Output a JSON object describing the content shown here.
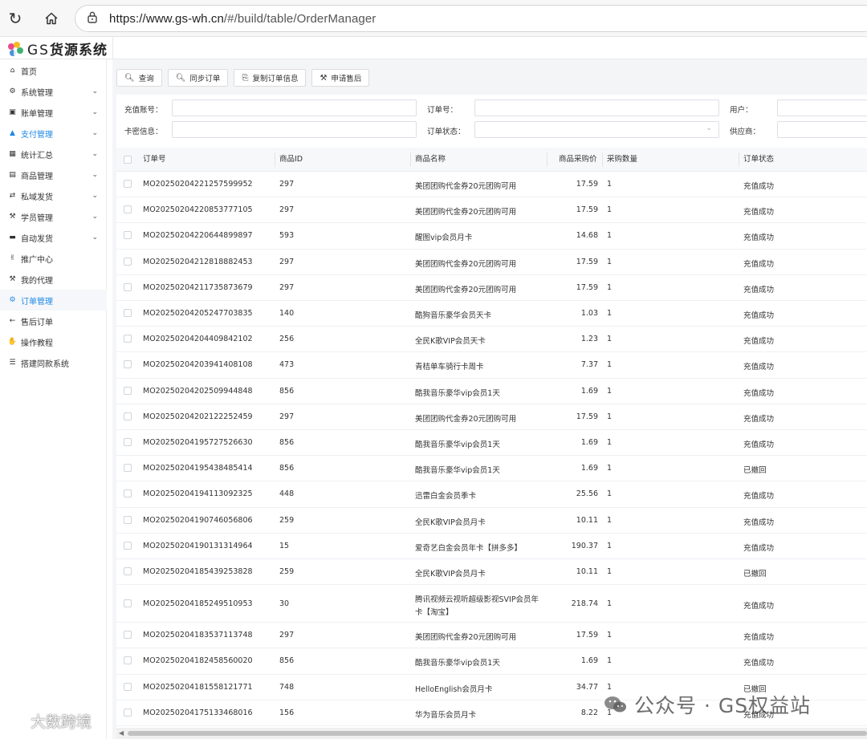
{
  "browser": {
    "url_host": "https://www.gs-wh.cn",
    "url_path": "/#/build/table/OrderManager"
  },
  "app": {
    "logo_prefix": "GS",
    "logo_title": "货源系统"
  },
  "sidebar": {
    "items": [
      {
        "label": "首页",
        "icon": "home-icon",
        "has_arrow": false
      },
      {
        "label": "系统管理",
        "icon": "gears-icon",
        "has_arrow": true
      },
      {
        "label": "账单管理",
        "icon": "money-icon",
        "has_arrow": true
      },
      {
        "label": "支付管理",
        "icon": "graduation-cap-icon",
        "has_arrow": true
      },
      {
        "label": "统计汇总",
        "icon": "table-icon",
        "has_arrow": true
      },
      {
        "label": "商品管理",
        "icon": "calendar-icon",
        "has_arrow": true
      },
      {
        "label": "私域发货",
        "icon": "random-icon",
        "has_arrow": true
      },
      {
        "label": "学员管理",
        "icon": "gavel-icon",
        "has_arrow": true
      },
      {
        "label": "自动发货",
        "icon": "car-icon",
        "has_arrow": true
      },
      {
        "label": "推广中心",
        "icon": "hand-peace-icon",
        "has_arrow": false
      },
      {
        "label": "我的代理",
        "icon": "gavel-icon",
        "has_arrow": false
      },
      {
        "label": "订单管理",
        "icon": "gear-icon",
        "has_arrow": false
      },
      {
        "label": "售后订单",
        "icon": "arrow-left-icon",
        "has_arrow": false
      },
      {
        "label": "操作教程",
        "icon": "sign-language-icon",
        "has_arrow": false
      },
      {
        "label": "搭建同款系统",
        "icon": "list-icon",
        "has_arrow": false
      }
    ]
  },
  "toolbar": {
    "query": "查询",
    "sync": "同步订单",
    "copy": "复制订单信息",
    "after_sale": "申请售后"
  },
  "filters": {
    "recharge_account": "充值账号：",
    "order_no": "订单号：",
    "user": "用户：",
    "card_info": "卡密信息：",
    "order_status": "订单状态：",
    "supplier": "供应商："
  },
  "table": {
    "headers": {
      "order_no": "订单号",
      "product_id": "商品ID",
      "product_name": "商品名称",
      "price": "商品采购价",
      "qty": "采购数量",
      "status": "订单状态"
    },
    "rows": [
      {
        "order_no": "MO20250204221257599952",
        "product_id": "297",
        "name": "美团团购代金券20元团购可用",
        "name2": "",
        "price": "17.59",
        "qty": "1",
        "status": "充值成功"
      },
      {
        "order_no": "MO20250204220853777105",
        "product_id": "297",
        "name": "美团团购代金券20元团购可用",
        "name2": "",
        "price": "17.59",
        "qty": "1",
        "status": "充值成功"
      },
      {
        "order_no": "MO20250204220644899897",
        "product_id": "593",
        "name": "醒图vip会员月卡",
        "name2": "",
        "price": "14.68",
        "qty": "1",
        "status": "充值成功"
      },
      {
        "order_no": "MO20250204212818882453",
        "product_id": "297",
        "name": "美团团购代金券20元团购可用",
        "name2": "",
        "price": "17.59",
        "qty": "1",
        "status": "充值成功"
      },
      {
        "order_no": "MO20250204211735873679",
        "product_id": "297",
        "name": "美团团购代金券20元团购可用",
        "name2": "",
        "price": "17.59",
        "qty": "1",
        "status": "充值成功"
      },
      {
        "order_no": "MO20250204205247703835",
        "product_id": "140",
        "name": "酷狗音乐豪华会员天卡",
        "name2": "",
        "price": "1.03",
        "qty": "1",
        "status": "充值成功"
      },
      {
        "order_no": "MO20250204204409842102",
        "product_id": "256",
        "name": "全民K歌VIP会员天卡",
        "name2": "",
        "price": "1.23",
        "qty": "1",
        "status": "充值成功"
      },
      {
        "order_no": "MO20250204203941408108",
        "product_id": "473",
        "name": "青桔单车骑行卡周卡",
        "name2": "",
        "price": "7.37",
        "qty": "1",
        "status": "充值成功"
      },
      {
        "order_no": "MO20250204202509944848",
        "product_id": "856",
        "name": "酷我音乐豪华vip会员1天",
        "name2": "",
        "price": "1.69",
        "qty": "1",
        "status": "充值成功"
      },
      {
        "order_no": "MO20250204202122252459",
        "product_id": "297",
        "name": "美团团购代金券20元团购可用",
        "name2": "",
        "price": "17.59",
        "qty": "1",
        "status": "充值成功"
      },
      {
        "order_no": "MO20250204195727526630",
        "product_id": "856",
        "name": "酷我音乐豪华vip会员1天",
        "name2": "",
        "price": "1.69",
        "qty": "1",
        "status": "充值成功"
      },
      {
        "order_no": "MO20250204195438485414",
        "product_id": "856",
        "name": "酷我音乐豪华vip会员1天",
        "name2": "",
        "price": "1.69",
        "qty": "1",
        "status": "已撤回"
      },
      {
        "order_no": "MO20250204194113092325",
        "product_id": "448",
        "name": "迅雷白金会员季卡",
        "name2": "",
        "price": "25.56",
        "qty": "1",
        "status": "充值成功"
      },
      {
        "order_no": "MO20250204190746056806",
        "product_id": "259",
        "name": "全民K歌VIP会员月卡",
        "name2": "",
        "price": "10.11",
        "qty": "1",
        "status": "充值成功"
      },
      {
        "order_no": "MO20250204190131314964",
        "product_id": "15",
        "name": "爱奇艺白金会员年卡【拼多多】",
        "name2": "",
        "price": "190.37",
        "qty": "1",
        "status": "充值成功"
      },
      {
        "order_no": "MO20250204185439253828",
        "product_id": "259",
        "name": "全民K歌VIP会员月卡",
        "name2": "",
        "price": "10.11",
        "qty": "1",
        "status": "已撤回"
      },
      {
        "order_no": "MO20250204185249510953",
        "product_id": "30",
        "name": "腾讯视频云视听超级影视SVIP会员年",
        "name2": "卡【淘宝】",
        "price": "218.74",
        "qty": "1",
        "status": "充值成功"
      },
      {
        "order_no": "MO20250204183537113748",
        "product_id": "297",
        "name": "美团团购代金券20元团购可用",
        "name2": "",
        "price": "17.59",
        "qty": "1",
        "status": "充值成功"
      },
      {
        "order_no": "MO20250204182458560020",
        "product_id": "856",
        "name": "酷我音乐豪华vip会员1天",
        "name2": "",
        "price": "1.69",
        "qty": "1",
        "status": "充值成功"
      },
      {
        "order_no": "MO20250204181558121771",
        "product_id": "748",
        "name": "HelloEnglish会员月卡",
        "name2": "",
        "price": "34.77",
        "qty": "1",
        "status": "已撤回"
      },
      {
        "order_no": "MO20250204175133468016",
        "product_id": "156",
        "name": "华为音乐会员月卡",
        "name2": "",
        "price": "8.22",
        "qty": "1",
        "status": "充值成功"
      }
    ]
  },
  "watermarks": {
    "left": "大数跨境",
    "right": "公众号 · GS权益站"
  },
  "colors": {
    "accent": "#1e88e5",
    "background": "#f4f5f7"
  }
}
